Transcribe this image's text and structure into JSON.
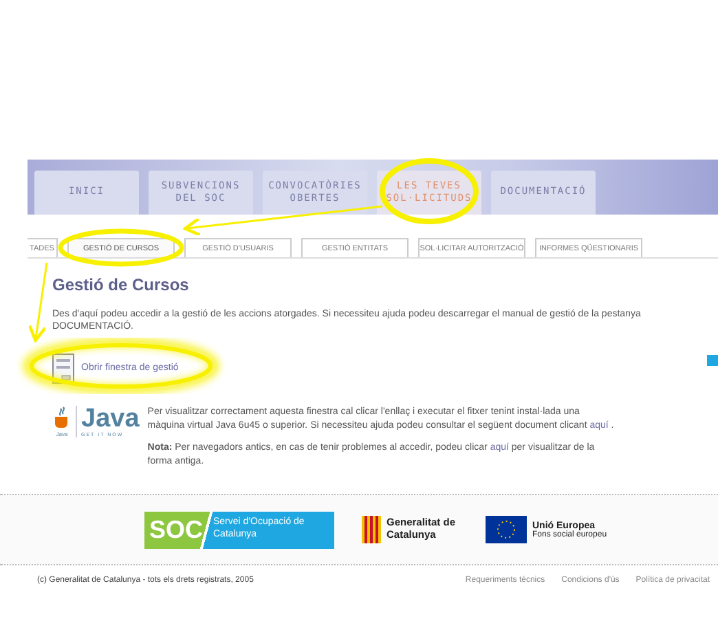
{
  "main_tabs": [
    {
      "label": "INICI",
      "selected": false
    },
    {
      "label": "SUBVENCIONS DEL SOC",
      "selected": false
    },
    {
      "label": "CONVOCATÒRIES OBERTES",
      "selected": false
    },
    {
      "label": "LES TEVES SOL·LICITUDS",
      "selected": true
    },
    {
      "label": "DOCUMENTACIÓ",
      "selected": false
    }
  ],
  "sub_tabs": [
    {
      "label": "TADES",
      "selected": false
    },
    {
      "label": "GESTIÓ DE CURSOS",
      "selected": true
    },
    {
      "label": "GESTIÓ D'USUARIS",
      "selected": false
    },
    {
      "label": "GESTIÓ ENTITATS",
      "selected": false
    },
    {
      "label": "SOL·LICITAR AUTORITZACIÓ",
      "selected": false
    },
    {
      "label": "INFORMES QÜESTIONARIS",
      "selected": false
    }
  ],
  "heading": "Gestió de Cursos",
  "intro": "Des d'aquí podeu accedir a la gestió de les accions atorgades. Si necessiteu ajuda podeu descarregar el manual de gestió de la pestanya DOCUMENTACIÓ.",
  "open_link": "Obrir finestra de gestió",
  "java_logo": {
    "word": "Java",
    "tagline": "GET IT NOW",
    "small": "Java"
  },
  "java_text": {
    "before": "Per visualitzar correctament aquesta finestra cal clicar l'enllaç i executar el fitxer tenint instal·lada una màquina virtual Java 6u45 o superior. Si necessiteu ajuda podeu consultar el següent document clicant",
    "link": "aquí",
    "after": "."
  },
  "note": {
    "before": "**Nota:** Per navegadors antics, en cas de tenir problemes al accedir, podeu clicar",
    "link": "aquí",
    "after": "per visualitzar de la forma antiga."
  },
  "logos": {
    "soc": "SOC",
    "soc_name": "Servei d'Ocupació de Catalunya",
    "gencat": "Generalitat de Catalunya",
    "eu_title": "Unió Europea",
    "eu_sub": "Fons social europeu"
  },
  "footer": {
    "copyright": "(c) Generalitat de Catalunya - tots els drets registrats, 2005",
    "links": [
      "Requeriments tècnics",
      "Condicions d'ús",
      "Política de privacitat"
    ]
  }
}
